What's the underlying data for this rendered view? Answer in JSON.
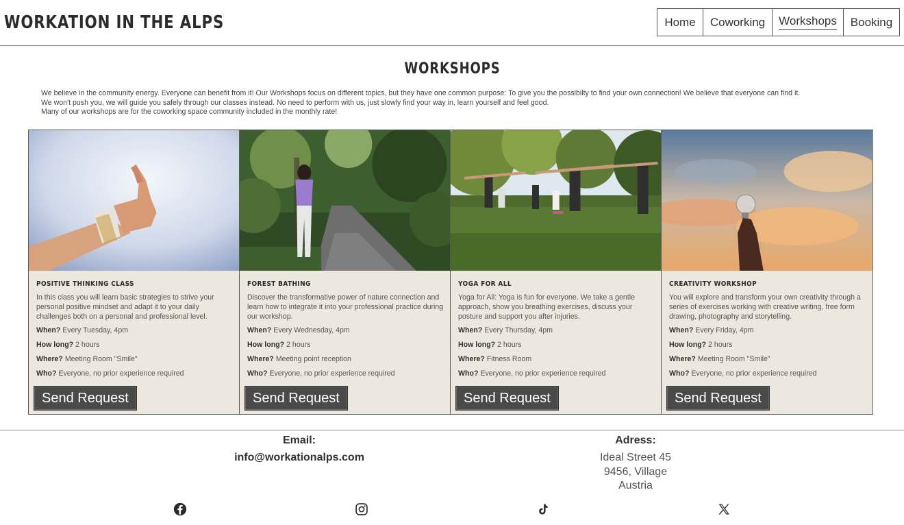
{
  "header": {
    "brand": "WORKATION IN THE ALPS",
    "nav": [
      {
        "label": "Home"
      },
      {
        "label": "Coworking"
      },
      {
        "label": "Workshops",
        "active": true
      },
      {
        "label": "Booking"
      }
    ]
  },
  "main": {
    "title": "WORKSHOPS",
    "intro": [
      "We believe in the community energy. Everyone can benefit from it! Our Workshops focus on different topics, but they have one common purpose: To give you the possibilty to find your own connection! We believe that everyone can find it.",
      "We won't push you, we will guide you safely through our classes instead. No need to perform with us, just slowly find your way in, learn yourself and feel good.",
      "Many of our workshops are for the coworking space community included in the monthly rate!"
    ],
    "labels": {
      "when": "When?",
      "how_long": "How long?",
      "where": "Where?",
      "who": "Who?"
    },
    "button_label": "Send Request",
    "workshops": [
      {
        "title": "POSITIVE THINKING CLASS",
        "image": "thumbs-up-photo",
        "description": "In this class you will learn basic strategies to strive your personal positive mindset and adapt it to your daily challenges both on a personal and professional level.",
        "when": "Every Tuesday, 4pm",
        "how_long": "2 hours",
        "where": "Meeting Room \"Smile\"",
        "who": "Everyone, no prior experience required"
      },
      {
        "title": "FOREST BATHING",
        "image": "forest-path-photo",
        "description": "Discover the transformative power of nature connection and learn how to integrate it into your professional practice during our workshop.",
        "when": "Every Wednesday, 4pm",
        "how_long": "2 hours",
        "where": "Meeting point reception",
        "who": "Everyone, no prior experience required"
      },
      {
        "title": "YOGA FOR ALL",
        "image": "outdoor-yoga-photo",
        "description": "Yoga for All: Yoga is fun for everyone. We take a gentle approach, show you breathing exercises, discuss your posture and support you after injuries.",
        "when": "Every Thursday, 4pm",
        "how_long": "2 hours",
        "where": "Fitness Room",
        "who": "Everyone, no prior experience required"
      },
      {
        "title": "CREATIVITY WORKSHOP",
        "image": "lightbulb-sky-photo",
        "description": "You will explore and transform your own creativity through a series of exercises working with creative writing, free form drawing, photography and storytelling.",
        "when": "Every Friday, 4pm",
        "how_long": "2 hours",
        "where": "Meeting Room \"Smile\"",
        "who": "Everyone, no prior experience required"
      }
    ]
  },
  "footer": {
    "email_label": "Email:",
    "email": "info@workationalps.com",
    "address_label": "Adress:",
    "address_lines": [
      "Ideal Street 45",
      "9456, Village",
      "Austria"
    ],
    "social": [
      "facebook-icon",
      "instagram-icon",
      "tiktok-icon",
      "x-icon"
    ]
  },
  "colors": {
    "card_background": "#ece7df",
    "button_background": "#4a4a4a",
    "border": "#5a5a5a",
    "text_dark": "#2b2b2b"
  }
}
